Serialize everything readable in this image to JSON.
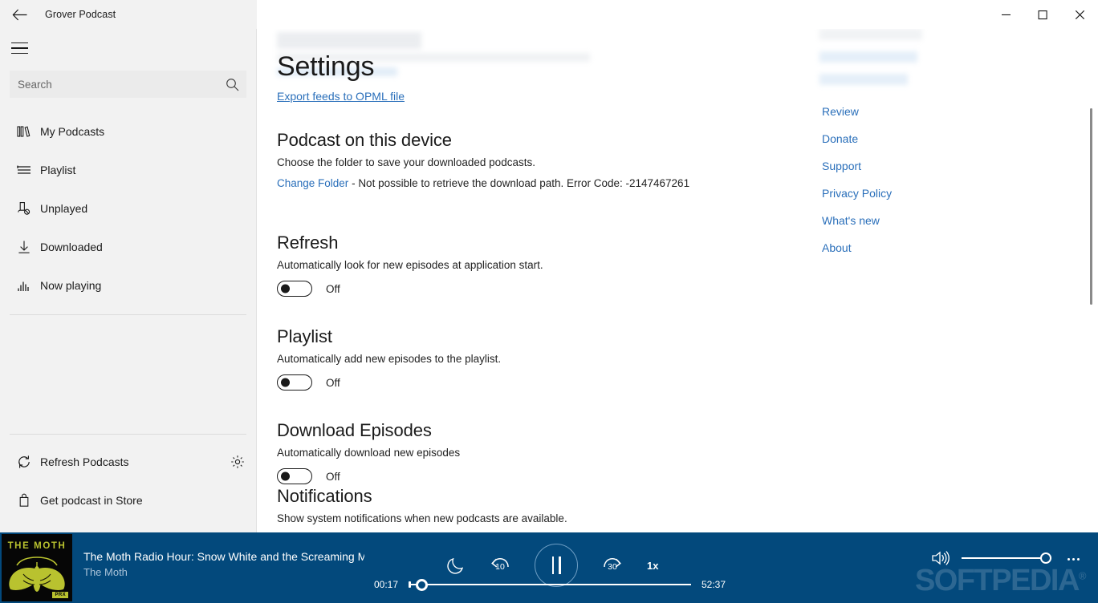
{
  "window": {
    "title": "Grover Podcast",
    "back_icon": "back-arrow-icon",
    "minimize_label": "—",
    "maximize_label": "□",
    "close_label": "✕"
  },
  "sidebar": {
    "menu_icon": "hamburger-icon",
    "search": {
      "placeholder": "Search",
      "value": "",
      "icon": "search-icon"
    },
    "items": [
      {
        "label": "My Podcasts",
        "icon": "library-icon"
      },
      {
        "label": "Playlist",
        "icon": "playlist-icon"
      },
      {
        "label": "Unplayed",
        "icon": "unplayed-icon"
      },
      {
        "label": "Downloaded",
        "icon": "download-icon"
      },
      {
        "label": "Now playing",
        "icon": "equalizer-icon"
      }
    ],
    "bottom_items": [
      {
        "label": "Refresh Podcasts",
        "icon": "refresh-icon",
        "trailing_icon": "gear-icon"
      },
      {
        "label": "Get podcast in Store",
        "icon": "store-bag-icon"
      }
    ]
  },
  "main": {
    "title": "Settings",
    "export_link": "Export feeds to OPML file",
    "sections": [
      {
        "title": "Podcast on this device",
        "desc": "Choose the folder to save your downloaded podcasts.",
        "link": "Change Folder",
        "separator": " - ",
        "error": "Not possible to retrieve the download path. Error Code: -2147467261"
      },
      {
        "title": "Refresh",
        "desc": "Automatically look for new episodes at application start.",
        "toggle": {
          "state": "Off",
          "on": false
        }
      },
      {
        "title": "Playlist",
        "desc": "Automatically add new episodes to the playlist.",
        "toggle": {
          "state": "Off",
          "on": false
        }
      },
      {
        "title": "Download Episodes",
        "desc": "Automatically download new episodes",
        "toggle": {
          "state": "Off",
          "on": false
        }
      },
      {
        "title": "Notifications",
        "desc": "Show system notifications when new podcasts are available."
      }
    ],
    "links": [
      "Review",
      "Donate",
      "Support",
      "Privacy Policy",
      "What's new",
      "About"
    ]
  },
  "player": {
    "artwork": {
      "title": "THE MOTH",
      "badge": "PRX",
      "bg_color": "#060606",
      "ink_color": "#b9c22f"
    },
    "track_title": "The Moth Radio Hour: Snow White and the Screaming M",
    "track_author": "The Moth",
    "controls": {
      "sleep_icon": "moon-sleep-icon",
      "rewind_label": "10",
      "play_state_icon": "pause-icon",
      "forward_label": "30",
      "speed": "1x"
    },
    "progress": {
      "current": "00:17",
      "total": "52:37",
      "percent": 2
    },
    "volume": {
      "icon": "volume-icon",
      "percent": 100
    },
    "more_icon": "more-ellipsis-icon",
    "watermark": "SOFTPEDIA",
    "watermark_mark": "®",
    "accent_color": "#03497c"
  }
}
